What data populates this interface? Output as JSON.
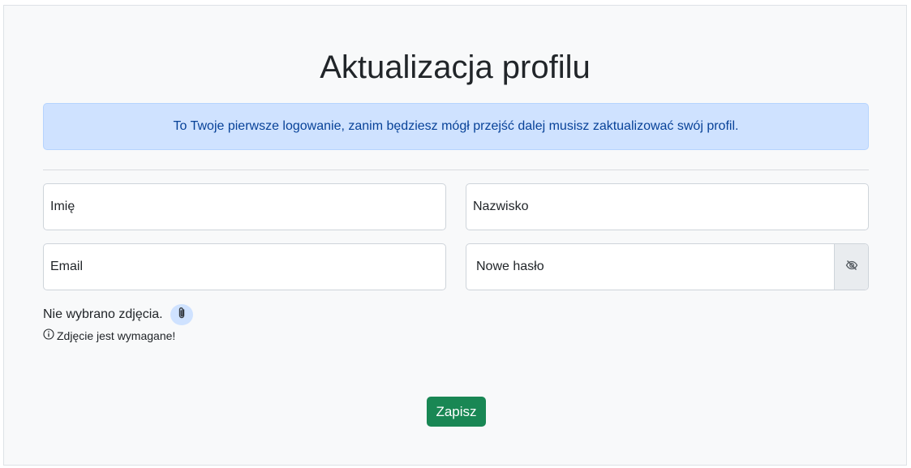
{
  "page": {
    "title": "Aktualizacja profilu"
  },
  "alert": {
    "text": "To Twoje pierwsze logowanie, zanim będziesz mógł przejść dalej musisz zaktualizować swój profil."
  },
  "form": {
    "first_name": {
      "placeholder": "Imię",
      "value": ""
    },
    "last_name": {
      "placeholder": "Nazwisko",
      "value": ""
    },
    "email": {
      "placeholder": "Email",
      "value": ""
    },
    "new_password": {
      "placeholder": "Nowe hasło",
      "value": ""
    },
    "password_toggle_icon": "eye-slash-icon",
    "photo_status": "Nie wybrano zdjęcia.",
    "attach_icon": "paperclip-icon",
    "photo_error": "Zdjęcie jest wymagane!",
    "error_icon": "info-circle-icon",
    "save_label": "Zapisz"
  },
  "colors": {
    "alert_bg": "#cfe2ff",
    "alert_text": "#084298",
    "save_button": "#198754",
    "card_bg": "#f8f9fa"
  }
}
